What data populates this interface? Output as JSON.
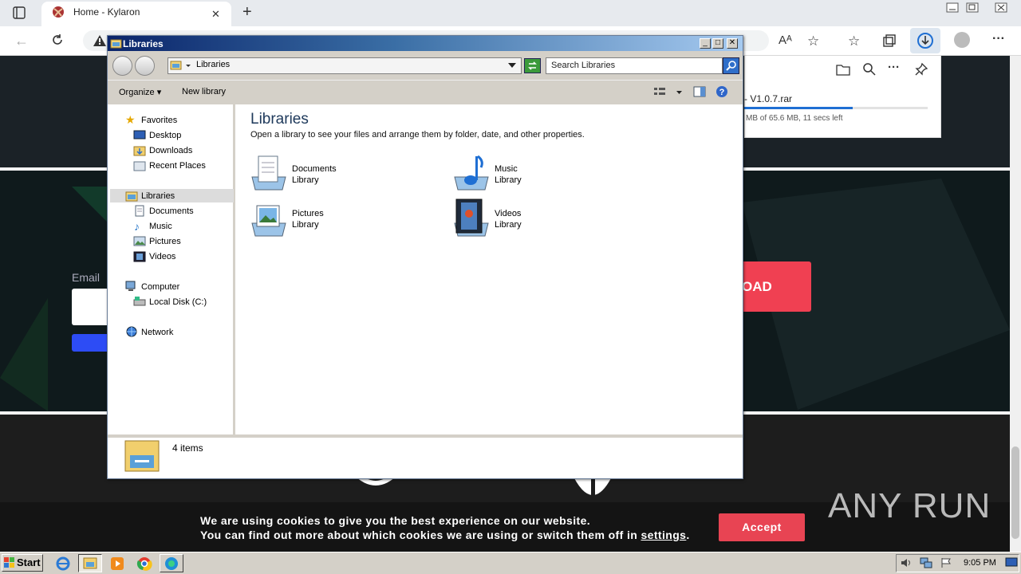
{
  "browser": {
    "tab_title": "Home - Kylaron",
    "download_file": "- V1.0.7.rar",
    "download_status": "MB of 65.6 MB, 11 secs left",
    "download_progress": 0.59
  },
  "website": {
    "email_label": "Email",
    "cta_partial": "OAD",
    "cookie_line1": "We are using cookies to give you the best experience on our website.",
    "cookie_line2_prefix": "You can find out more about which cookies we are using or switch them off in ",
    "cookie_link": "settings",
    "cookie_line2_suffix": ".",
    "accept_label": "Accept",
    "watermark": "ANY RUN"
  },
  "explorer": {
    "title": "Libraries",
    "address": "Libraries",
    "search_placeholder": "Search Libraries",
    "toolbar": {
      "organize": "Organize",
      "new_library": "New library"
    },
    "nav": {
      "favorites": "Favorites",
      "desktop": "Desktop",
      "downloads": "Downloads",
      "recent": "Recent Places",
      "libraries": "Libraries",
      "documents": "Documents",
      "music": "Music",
      "pictures": "Pictures",
      "videos": "Videos",
      "computer": "Computer",
      "local_disk": "Local Disk (C:)",
      "network": "Network"
    },
    "content_title": "Libraries",
    "content_desc": "Open a library to see your files and arrange them by folder, date, and other properties.",
    "libraries": [
      {
        "name": "Documents",
        "type": "Library"
      },
      {
        "name": "Music",
        "type": "Library"
      },
      {
        "name": "Pictures",
        "type": "Library"
      },
      {
        "name": "Videos",
        "type": "Library"
      }
    ],
    "status": "4 items"
  },
  "taskbar": {
    "start": "Start",
    "clock": "9:05 PM"
  }
}
